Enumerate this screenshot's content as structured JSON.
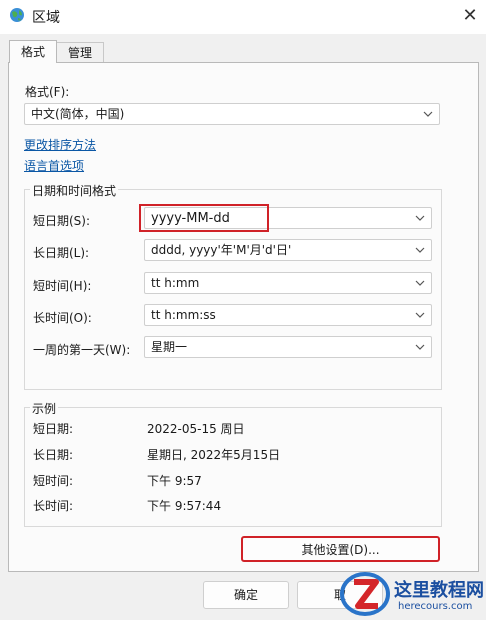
{
  "window": {
    "title": "区域",
    "close_glyph": "✕"
  },
  "tabs": [
    {
      "label": "格式",
      "active": true
    },
    {
      "label": "管理",
      "active": false
    }
  ],
  "format": {
    "label": "格式(F):",
    "value": "中文(简体，中国)"
  },
  "links": {
    "sort": "更改排序方法",
    "language": "语言首选项"
  },
  "datetime_group": {
    "caption": "日期和时间格式",
    "rows": [
      {
        "label": "短日期(S):",
        "value": "yyyy-MM-dd"
      },
      {
        "label": "长日期(L):",
        "value": "dddd, yyyy'年'M'月'd'日'"
      },
      {
        "label": "短时间(H):",
        "value": "tt h:mm"
      },
      {
        "label": "长时间(O):",
        "value": "tt h:mm:ss"
      },
      {
        "label": "一周的第一天(W):",
        "value": "星期一"
      }
    ]
  },
  "example_group": {
    "caption": "示例",
    "rows": [
      {
        "label": "短日期:",
        "value": "2022-05-15 周日"
      },
      {
        "label": "长日期:",
        "value": "星期日, 2022年5月15日"
      },
      {
        "label": "短时间:",
        "value": "下午 9:57"
      },
      {
        "label": "长时间:",
        "value": "下午 9:57:44"
      }
    ]
  },
  "buttons": {
    "other_settings": "其他设置(D)...",
    "ok": "确定",
    "cancel": "取"
  },
  "watermark": {
    "site_name": "这里教程网",
    "site_url": "herecours.com"
  },
  "colors": {
    "highlight": "#d02228",
    "link": "#0b57a5"
  },
  "icons": {
    "title": "globe-icon",
    "dropdown": "chevron-down-icon",
    "watermark": "z-logo-icon"
  }
}
